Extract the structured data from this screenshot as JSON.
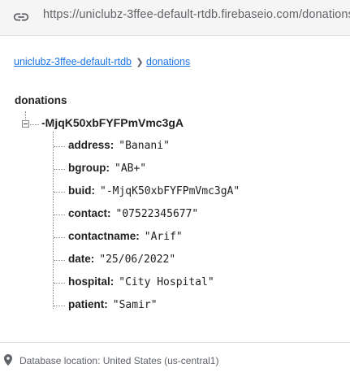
{
  "url_bar": {
    "icon": "link-icon",
    "url": "https://uniclubz-3ffee-default-rtdb.firebaseio.com/donations"
  },
  "breadcrumb": {
    "items": [
      "uniclubz-3ffee-default-rtdb",
      "donations"
    ],
    "separator_icon": "chevron-right-icon"
  },
  "tree": {
    "root_label": "donations",
    "node": {
      "key": "-MjqK50xbFYFPmVmc3gA",
      "fields": [
        {
          "key": "address",
          "value": "\"Banani\""
        },
        {
          "key": "bgroup",
          "value": "\"AB+\""
        },
        {
          "key": "buid",
          "value": "\"-MjqK50xbFYFPmVmc3gA\""
        },
        {
          "key": "contact",
          "value": "\"07522345677\""
        },
        {
          "key": "contactname",
          "value": "\"Arif\""
        },
        {
          "key": "date",
          "value": "\"25/06/2022\""
        },
        {
          "key": "hospital",
          "value": "\"City Hospital\""
        },
        {
          "key": "patient",
          "value": "\"Samir\""
        }
      ]
    }
  },
  "footer": {
    "icon": "location-pin-icon",
    "text": "Database location: United States (us-central1)"
  },
  "colors": {
    "link": "#1a73e8",
    "text": "#212121",
    "muted": "#5f6368",
    "urlbar_bg": "#f5f5f5"
  }
}
